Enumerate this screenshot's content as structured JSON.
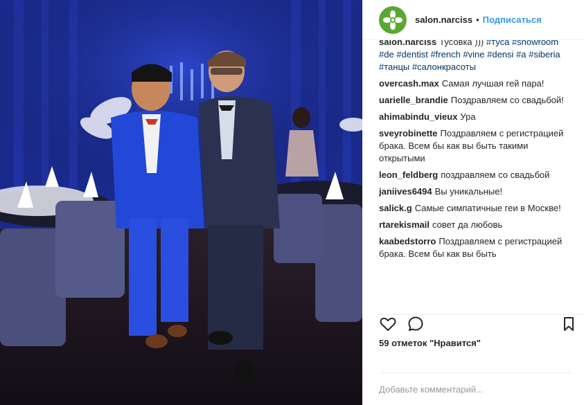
{
  "post": {
    "photo_alt": "two men posing in a restaurant"
  },
  "header": {
    "username": "salon.narciss",
    "separator": "•",
    "follow_label": "Подписаться"
  },
  "caption": {
    "username": "salon.narciss",
    "text": "Тусовка )))",
    "tags": "#туса #showroom #de #dentist #french #vine #densi #a #siberia #танцы #салонкрасоты"
  },
  "comments": [
    {
      "username": "overcash.max",
      "text": "Самая лучшая гей пара!"
    },
    {
      "username": "uarielle_brandie",
      "text": "Поздравляем со свадьбой!"
    },
    {
      "username": "ahimabindu_vieux",
      "text": "Ура"
    },
    {
      "username": "sveyrobinette",
      "text": "Поздравляем с регистрацией брака. Всем бы как вы быть такими открытыми"
    },
    {
      "username": "leon_feldberg",
      "text": "поздравляем со свадьбой"
    },
    {
      "username": "janiives6494",
      "text": "Вы уникальные!"
    },
    {
      "username": "salick.g",
      "text": "Самые симпатичные геи в Москве!"
    },
    {
      "username": "rtarekismail",
      "text": "совет да любовь"
    },
    {
      "username": "kaabedstorro",
      "text": "Поздравляем с регистрацией брака. Всем бы как вы быть"
    }
  ],
  "actions": {
    "like_icon": "heart-icon",
    "comment_icon": "speech-bubble-icon",
    "save_icon": "bookmark-icon"
  },
  "likes_text": "59 отметок \"Нравится\"",
  "add_comment": {
    "placeholder": "Добавьте комментарий..."
  },
  "colors": {
    "link": "#3897f0",
    "hashtag": "#003569",
    "avatar": "#5aa832"
  }
}
